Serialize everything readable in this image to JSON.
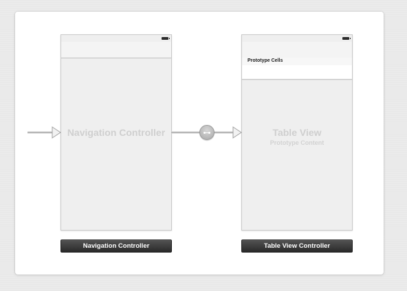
{
  "storyboard": {
    "navigation_scene": {
      "watermark": "Navigation Controller",
      "dock_label": "Navigation Controller"
    },
    "table_scene": {
      "watermark": "Table View",
      "watermark_sub": "Prototype Content",
      "section_header": "Prototype Cells",
      "dock_label": "Table View Controller"
    },
    "segue": {
      "icon": "relationship-segue-icon"
    },
    "entry_point": {
      "icon": "initial-view-controller-arrow-icon"
    }
  },
  "colors": {
    "board_background": "#ffffff",
    "canvas_background": "#ebebeb",
    "scene_background": "#efefef",
    "dock_background": "#2a2a2a",
    "watermark_text": "#cfcfcf"
  }
}
